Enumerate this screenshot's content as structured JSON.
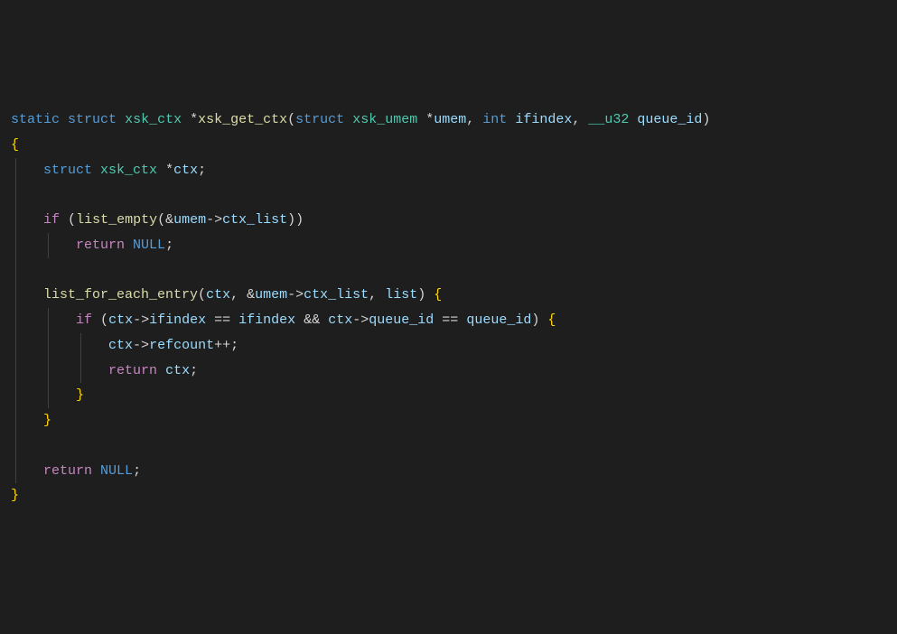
{
  "code": {
    "l1_static": "static",
    "l1_struct1": "struct",
    "l1_type1": "xsk_ctx",
    "l1_star1": "*",
    "l1_fn": "xsk_get_ctx",
    "l1_lp": "(",
    "l1_struct2": "struct",
    "l1_type2": "xsk_umem",
    "l1_star2": "*",
    "l1_p1": "umem",
    "l1_c1": ",",
    "l1_int": "int",
    "l1_p2": "ifindex",
    "l1_c2": ",",
    "l1_type3": "__u32",
    "l1_p3": "queue_id",
    "l1_rp": ")",
    "l2_ob": "{",
    "l3_struct": "struct",
    "l3_type": "xsk_ctx",
    "l3_star": "*",
    "l3_var": "ctx",
    "l3_sc": ";",
    "l5_if": "if",
    "l5_lp": "(",
    "l5_fn": "list_empty",
    "l5_lp2": "(",
    "l5_amp": "&",
    "l5_var": "umem",
    "l5_arrow": "->",
    "l5_mem": "ctx_list",
    "l5_rp2": ")",
    "l5_rp": ")",
    "l6_ret": "return",
    "l6_null": "NULL",
    "l6_sc": ";",
    "l8_fn": "list_for_each_entry",
    "l8_lp": "(",
    "l8_a1": "ctx",
    "l8_c1": ",",
    "l8_amp": "&",
    "l8_var": "umem",
    "l8_arrow": "->",
    "l8_mem": "ctx_list",
    "l8_c2": ",",
    "l8_a3": "list",
    "l8_rp": ")",
    "l8_ob": "{",
    "l9_if": "if",
    "l9_lp": "(",
    "l9_v1": "ctx",
    "l9_ar1": "->",
    "l9_m1": "ifindex",
    "l9_eq1": "==",
    "l9_v2": "ifindex",
    "l9_and": "&&",
    "l9_v3": "ctx",
    "l9_ar2": "->",
    "l9_m2": "queue_id",
    "l9_eq2": "==",
    "l9_v4": "queue_id",
    "l9_rp": ")",
    "l9_ob": "{",
    "l10_v": "ctx",
    "l10_ar": "->",
    "l10_m": "refcount",
    "l10_pp": "++",
    "l10_sc": ";",
    "l11_ret": "return",
    "l11_v": "ctx",
    "l11_sc": ";",
    "l12_cb": "}",
    "l13_cb": "}",
    "l15_ret": "return",
    "l15_null": "NULL",
    "l15_sc": ";",
    "l16_cb": "}"
  }
}
